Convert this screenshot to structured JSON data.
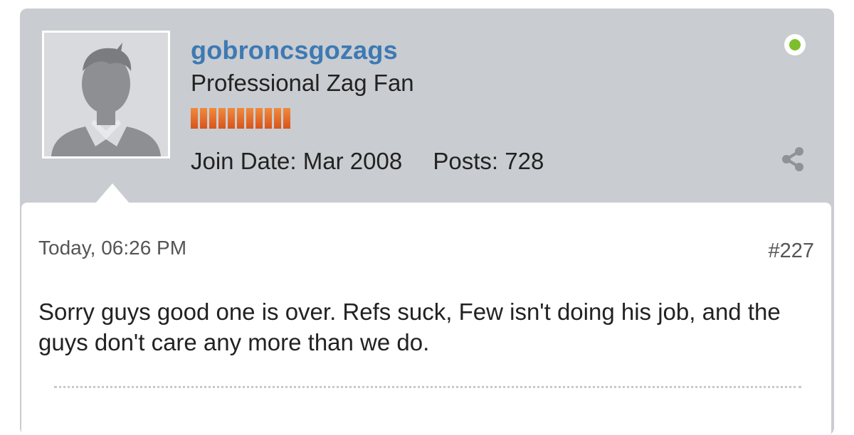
{
  "user": {
    "username": "gobroncsgozags",
    "title": "Professional Zag Fan",
    "reputation_level": 11,
    "join_date_label": "Join Date:",
    "join_date": "Mar 2008",
    "posts_label": "Posts:",
    "posts": "728",
    "online_color": "#7cbf2b"
  },
  "post": {
    "timestamp": "Today, 06:26 PM",
    "number": "#227",
    "message": "Sorry guys good one is over. Refs suck, Few isn't doing his job, and the guys don't care any more than we do."
  },
  "colors": {
    "username": "#3d79b4",
    "header_bg": "#c9ccd0",
    "reputation": "#e06a24"
  },
  "icons": [
    "avatar-placeholder-icon",
    "online-status-icon",
    "share-icon"
  ]
}
